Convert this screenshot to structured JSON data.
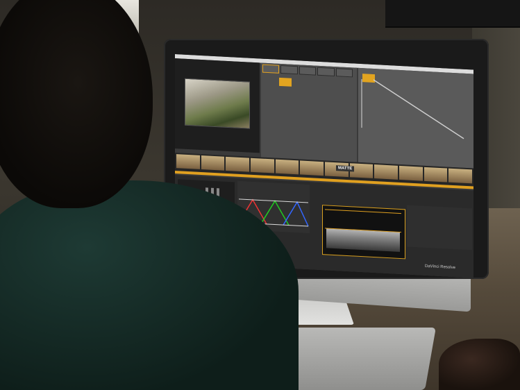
{
  "scene": {
    "screen": {
      "app_label": "DaVinci Resolve",
      "thumbnail_label": "MATTE"
    },
    "monitor_brand_icon": "apple-logo-icon"
  }
}
